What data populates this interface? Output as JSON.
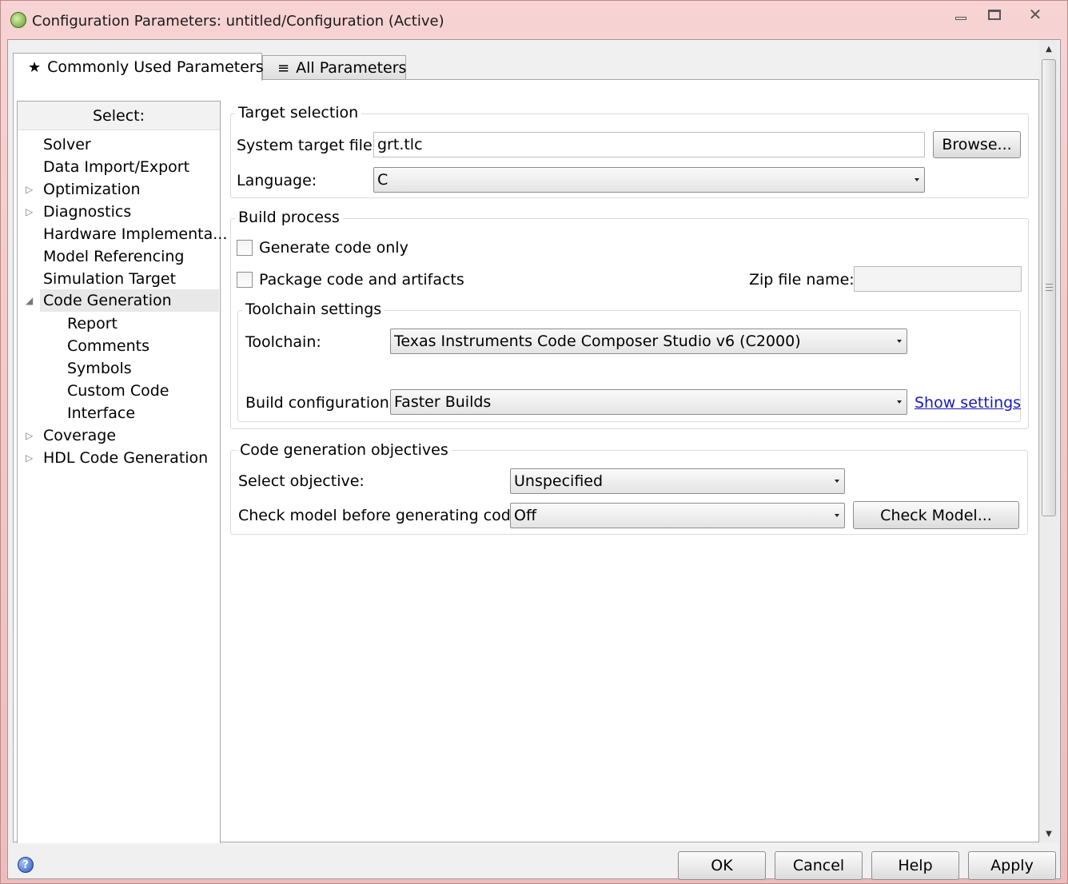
{
  "window": {
    "title": "Configuration Parameters: untitled/Configuration (Active)"
  },
  "tabs": [
    {
      "label": "Commonly Used Parameters",
      "icon": "star-icon",
      "glyph": "★"
    },
    {
      "label": "All Parameters",
      "icon": "list-icon",
      "glyph": "≡"
    }
  ],
  "tree": {
    "header": "Select:",
    "items": [
      {
        "label": "Solver"
      },
      {
        "label": "Data Import/Export"
      },
      {
        "label": "Optimization",
        "expandable": true
      },
      {
        "label": "Diagnostics",
        "expandable": true
      },
      {
        "label": "Hardware Implementa..."
      },
      {
        "label": "Model Referencing"
      },
      {
        "label": "Simulation Target"
      },
      {
        "label": "Code Generation",
        "expanded": true,
        "selected": true
      },
      {
        "label": "Report"
      },
      {
        "label": "Comments"
      },
      {
        "label": "Symbols"
      },
      {
        "label": "Custom Code"
      },
      {
        "label": "Interface"
      },
      {
        "label": "Coverage",
        "expandable": true
      },
      {
        "label": "HDL Code Generation",
        "expandable": true
      }
    ]
  },
  "target_selection": {
    "title": "Target selection",
    "system_target_label": "System target file:",
    "system_target_value": "grt.tlc",
    "browse_label": "Browse...",
    "language_label": "Language:",
    "language_value": "C"
  },
  "build_process": {
    "title": "Build process",
    "generate_code_only_label": "Generate code only",
    "generate_code_only_checked": false,
    "package_label": "Package code and artifacts",
    "package_checked": false,
    "zip_label": "Zip file name:",
    "zip_value": "",
    "toolchain_settings": {
      "title": "Toolchain settings",
      "toolchain_label": "Toolchain:",
      "toolchain_value": "Texas Instruments Code Composer Studio v6 (C2000)",
      "build_config_label": "Build configuration:",
      "build_config_value": "Faster Builds",
      "show_settings_label": "Show settings"
    }
  },
  "objectives": {
    "title": "Code generation objectives",
    "select_objective_label": "Select objective:",
    "select_objective_value": "Unspecified",
    "check_model_label": "Check model before generating code:",
    "check_model_value": "Off",
    "check_model_button": "Check Model..."
  },
  "footer": {
    "ok": "OK",
    "cancel": "Cancel",
    "help": "Help",
    "apply": "Apply"
  },
  "colors": {
    "title_bar": "#f2c9c9",
    "link": "#1a1ab8",
    "selected_row": "#e8e8e8"
  }
}
